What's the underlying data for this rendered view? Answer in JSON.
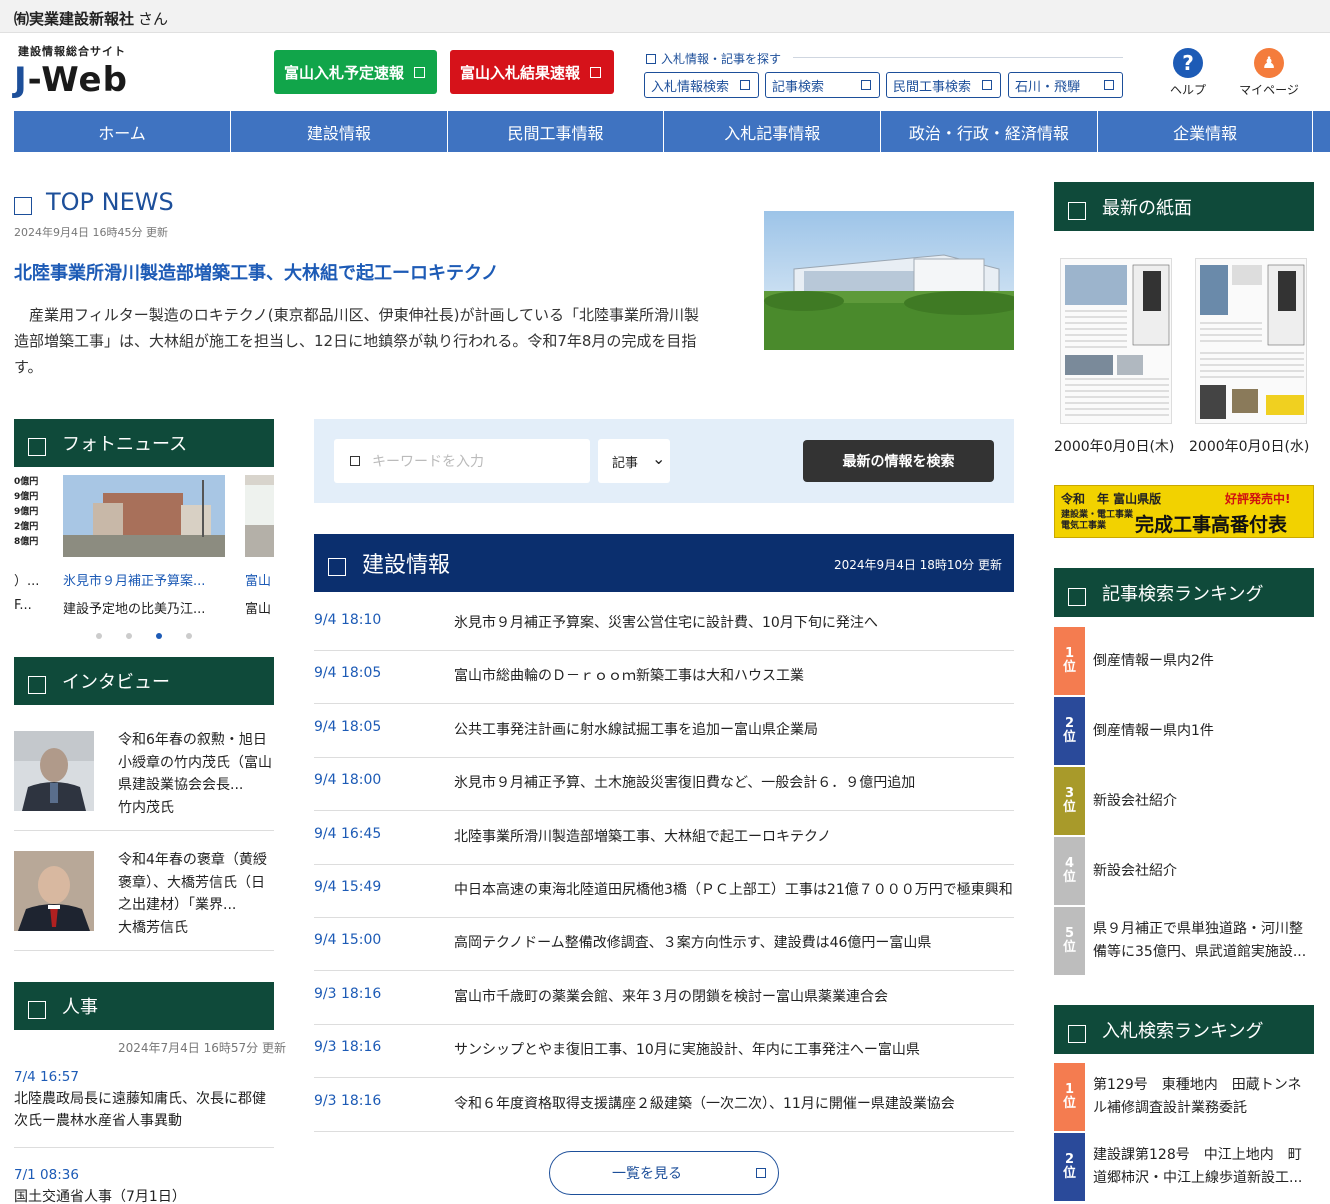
{
  "topbar": {
    "company": "㈲実業建設新報社",
    "san": "さん"
  },
  "header": {
    "site_sub": "建設情報総合サイト",
    "logo_j": "J",
    "logo_rest": "-Web",
    "btn_yotei": "富山入札予定速報",
    "btn_kekka": "富山入札結果速報",
    "search_caption": "入札情報・記事を探す",
    "search_buttons": [
      "入札情報検索",
      "記事検索",
      "民間工事検索",
      "石川・飛騨"
    ],
    "help": "ヘルプ",
    "help_glyph": "?",
    "mypage": "マイページ",
    "mypage_glyph": "♟"
  },
  "nav": [
    "ホーム",
    "建設情報",
    "民間工事情報",
    "入札記事情報",
    "政治・行政・経済情報",
    "企業情報"
  ],
  "top_news": {
    "title": "TOP NEWS",
    "updated": "2024年9月4日 16時45分 更新",
    "headline": "北陸事業所滑川製造部増築工事、大林組で起工ーロキテクノ",
    "body": "産業用フィルター製造のロキテクノ(東京都品川区、伊東伸社長)が計画している「北陸事業所滑川製造部増築工事」は、大林組が施工を担当し、12日に地鎮祭が執り行われる。令和7年8月の完成を目指す。"
  },
  "photo_news": {
    "title": "フォトニュース",
    "items": [
      {
        "cap1": "）...",
        "cap2": "F..."
      },
      {
        "cap1": "氷見市９月補正予算案...",
        "cap2": "建設予定地の比美乃江..."
      },
      {
        "cap1": "富山",
        "cap2": "富山"
      }
    ],
    "chart_fragment": [
      "0億円",
      "9億円",
      "9億円",
      "2億円",
      "8億円"
    ]
  },
  "interview": {
    "title": "インタビュー",
    "items": [
      {
        "text": "令和6年春の叙勲・旭日小綬章の竹内茂氏（富山県建設業協会会長...",
        "name": "竹内茂氏"
      },
      {
        "text": "令和4年春の褒章（黄綬褒章）、大橋芳信氏（日之出建材）「業界...",
        "name": "大橋芳信氏"
      }
    ]
  },
  "jinji": {
    "title": "人事",
    "updated": "2024年7月4日 16時57分 更新",
    "items": [
      {
        "time": "7/4 16:57",
        "text": "北陸農政局長に遠藤知庸氏、次長に郡健次氏ー農林水産省人事異動"
      },
      {
        "time": "7/1 08:36",
        "text": "国土交通省人事（7月1日）"
      }
    ]
  },
  "search": {
    "placeholder": "キーワードを入力",
    "select": "記事",
    "select_arrow": "⌄",
    "button": "最新の情報を検索"
  },
  "kensetsu": {
    "title": "建設情報",
    "updated": "2024年9月4日 18時10分 更新",
    "rows": [
      {
        "time": "9/4 18:10",
        "headline": "氷見市９月補正予算案、災害公営住宅に設計費、10月下旬に発注へ"
      },
      {
        "time": "9/4 18:05",
        "headline": "富山市総曲輪のＤ－ｒｏｏｍ新築工事は大和ハウス工業"
      },
      {
        "time": "9/4 18:05",
        "headline": "公共工事発注計画に射水線試掘工事を追加ー富山県企業局"
      },
      {
        "time": "9/4 18:00",
        "headline": "氷見市９月補正予算、土木施設災害復旧費など、一般会計６．９億円追加"
      },
      {
        "time": "9/4 16:45",
        "headline": "北陸事業所滑川製造部増築工事、大林組で起工ーロキテクノ"
      },
      {
        "time": "9/4 15:49",
        "headline": "中日本高速の東海北陸道田尻橋他3橋（ＰＣ上部工）工事は21億７０００万円で極東興和"
      },
      {
        "time": "9/4 15:00",
        "headline": "高岡テクノドーム整備改修調査、３案方向性示す、建設費は46億円ー富山県"
      },
      {
        "time": "9/3 18:16",
        "headline": "富山市千歳町の薬業会館、来年３月の閉鎖を検討ー富山県薬業連合会"
      },
      {
        "time": "9/3 18:16",
        "headline": "サンシップとやま復旧工事、10月に実施設計、年内に工事発注へー富山県"
      },
      {
        "time": "9/3 18:16",
        "headline": "令和６年度資格取得支援講座２級建築（一次二次）、11月に開催ー県建設業協会"
      }
    ],
    "more": "一覧を見る"
  },
  "shimen": {
    "title": "最新の紙面",
    "dates": [
      "2000年0月0日(木)",
      "2000年0月0日(水)"
    ]
  },
  "banner": {
    "line1": "令和　年 富山県版",
    "hot": "好評発売中!",
    "line2a": "建設業・電工事業",
    "line2b": "電気工事業",
    "big": "完成工事高番付表"
  },
  "article_ranking": {
    "title": "記事検索ランキング",
    "items": [
      {
        "n": "1",
        "rank": "位",
        "color": "#f47c50",
        "text": "倒産情報ー県内2件"
      },
      {
        "n": "2",
        "rank": "位",
        "color": "#2a4a9a",
        "text": "倒産情報ー県内1件"
      },
      {
        "n": "3",
        "rank": "位",
        "color": "#a89a2a",
        "text": "新設会社紹介"
      },
      {
        "n": "4",
        "rank": "位",
        "color": "#bdbdbd",
        "text": "新設会社紹介"
      },
      {
        "n": "5",
        "rank": "位",
        "color": "#bdbdbd",
        "text": "県９月補正で県単独道路・河川整備等に35億円、県武道館実施設..."
      }
    ]
  },
  "bid_ranking": {
    "title": "入札検索ランキング",
    "items": [
      {
        "n": "1",
        "rank": "位",
        "color": "#f47c50",
        "text": "第129号　東種地内　田蔵トンネル補修調査設計業務委託"
      },
      {
        "n": "2",
        "rank": "位",
        "color": "#2a4a9a",
        "text": "建設課第128号　中江上地内　町道郷柿沢・中江上線歩道新設工..."
      }
    ]
  },
  "colors": {
    "brand_blue": "#1d4f9a",
    "nav_blue": "#3f73c1",
    "dark_green": "#0f4a3a",
    "navy": "#0b2f6e"
  }
}
